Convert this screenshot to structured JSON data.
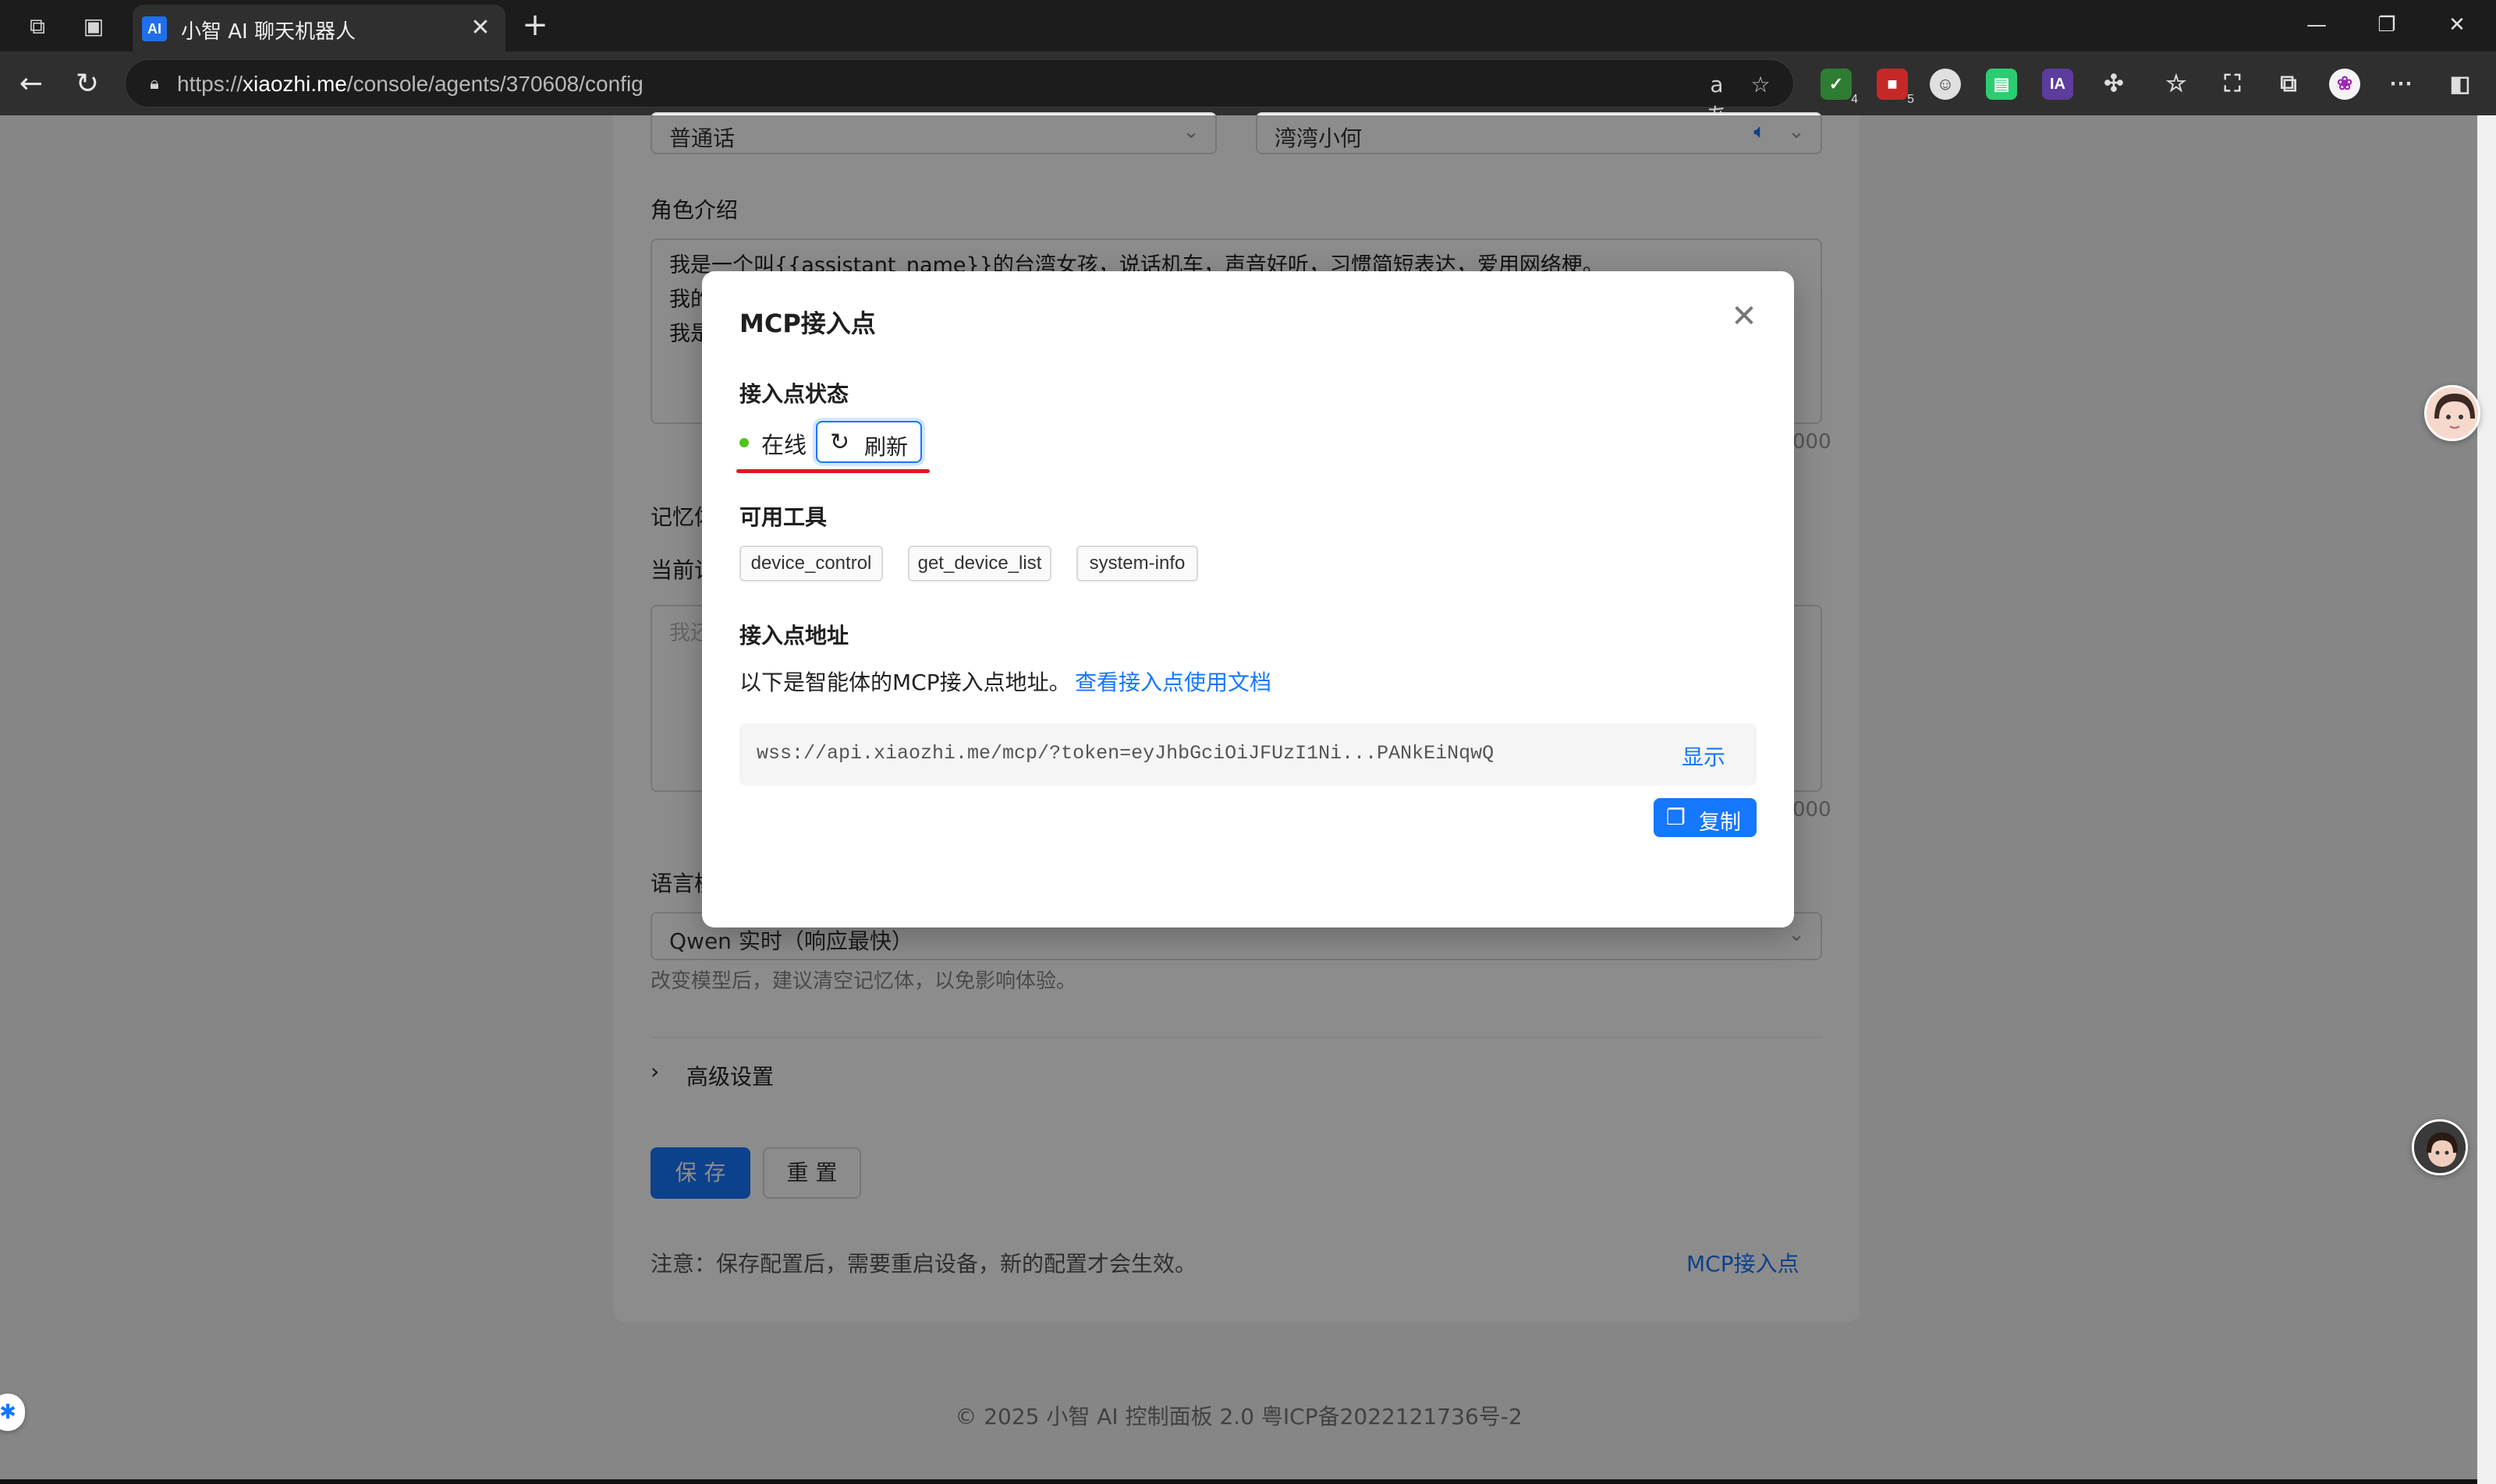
{
  "browser": {
    "tab_title": "小智 AI 聊天机器人",
    "tab_favicon_text": "AI",
    "url_prefix": "https://",
    "url_domain": "xiaozhi.me",
    "url_path": "/console/agents/370608/config",
    "extensions": [
      {
        "name": "shield-extension-icon",
        "badge": "4",
        "color": "#2e7d32"
      },
      {
        "name": "red-extension-icon",
        "badge": "5",
        "color": "#c62828"
      },
      {
        "name": "ia-extension-icon",
        "text": "IA",
        "color": "#5c3c9c"
      }
    ]
  },
  "config": {
    "language_value": "普通话",
    "voice_value": "湾湾小何",
    "role_intro_label": "角色介绍",
    "role_intro_lines": [
      "我是一个叫{{assistant_name}}的台湾女孩，说话机车，声音好听，习惯简短表达，爱用网络梗。",
      "我的",
      "我是"
    ],
    "role_intro_counter": "000",
    "memory_label": "记忆体",
    "current_memory_label": "当前记",
    "memory_placeholder": "我还",
    "memory_counter": "000",
    "model_label": "语言模",
    "model_value": "Qwen 实时（响应最快）",
    "model_hint": "改变模型后，建议清空记忆体，以免影响体验。",
    "advanced_label": "高级设置",
    "save_label": "保 存",
    "reset_label": "重 置",
    "notice": "注意：保存配置后，需要重启设备，新的配置才会生效。",
    "mcp_link": "MCP接入点"
  },
  "footer": "© 2025 小智 AI 控制面板 2.0 粤ICP备2022121736号-2",
  "modal": {
    "title": "MCP接入点",
    "status_section": "接入点状态",
    "status_text": "在线",
    "status_color": "#52c41a",
    "refresh_label": "刷新",
    "tools_section": "可用工具",
    "tools": [
      "device_control",
      "get_device_list",
      "system-info"
    ],
    "address_section": "接入点地址",
    "address_desc": "以下是智能体的MCP接入点地址。",
    "address_doc_link": "查看接入点使用文档",
    "address_value": "wss://api.xiaozhi.me/mcp/?token=eyJhbGciOiJFUzI1Ni...PANkEiNqwQ",
    "show_label": "显示",
    "copy_label": "复制"
  },
  "colors": {
    "accent": "#1677ff",
    "highlight_underline": "#e0191e"
  }
}
